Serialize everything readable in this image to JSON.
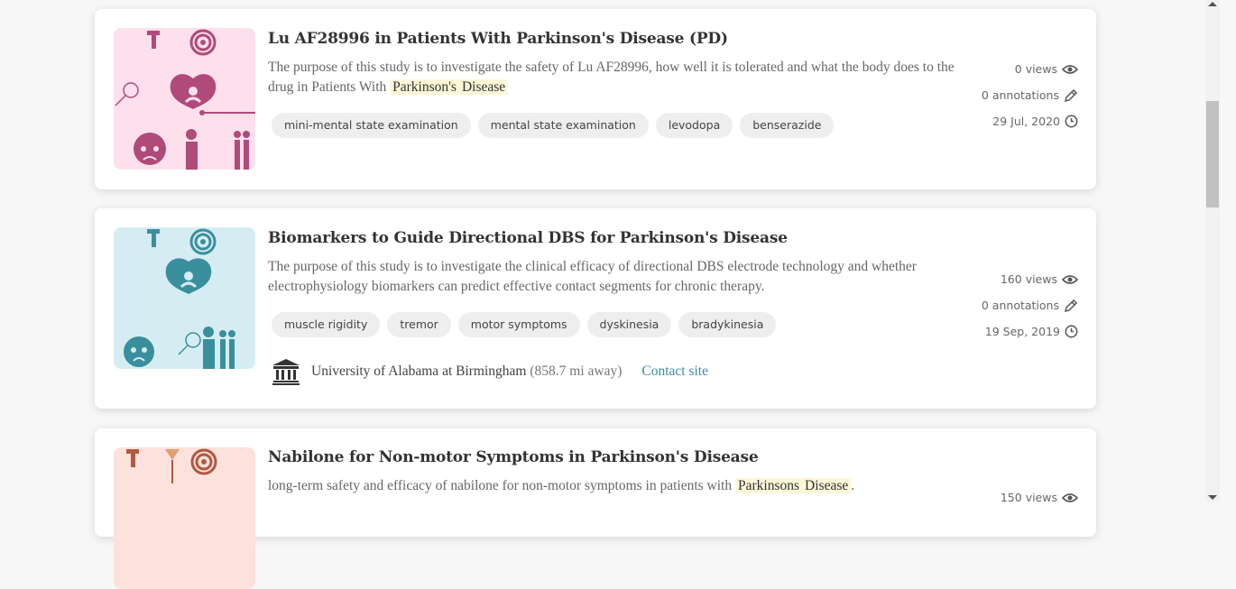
{
  "colors": {
    "pink_bg": "#fde0ec",
    "pink_fg": "#b04a7a",
    "teal_bg": "#d5edf2",
    "teal_fg": "#3a8f9d",
    "salmon_bg": "#fde1dc",
    "salmon_fg": "#b05a40",
    "highlight": "#fdf6d8",
    "link": "#3d8ba6"
  },
  "cards": [
    {
      "title": "Lu AF28996 in Patients With Parkinson's Disease (PD)",
      "desc_before": "The purpose of this study is to investigate the safety of Lu AF28996, how well it is tolerated and what the body does to the drug in Patients With",
      "highlights": [
        "Parkinson's",
        "Disease"
      ],
      "tags": [
        "mini-mental state examination",
        "mental state examination",
        "levodopa",
        "benserazide"
      ],
      "views": "0 views",
      "annotations": "0 annotations",
      "date": "29 Jul, 2020"
    },
    {
      "title": "Biomarkers to Guide Directional DBS for Parkinson's Disease",
      "desc": "The purpose of this study is to investigate the clinical efficacy of directional DBS electrode technology and whether electrophysiology biomarkers can predict effective contact segments for chronic therapy.",
      "tags": [
        "muscle rigidity",
        "tremor",
        "motor symptoms",
        "dyskinesia",
        "bradykinesia"
      ],
      "views": "160 views",
      "annotations": "0 annotations",
      "date": "19 Sep, 2019",
      "site_name": "University of Alabama at Birmingham",
      "site_distance": "(858.7 mi away)",
      "contact_label": "Contact site"
    },
    {
      "title": "Nabilone for Non-motor Symptoms in Parkinson's Disease",
      "desc_before": "long-term safety and efficacy of nabilone for non-motor symptoms in patients with",
      "highlights": [
        "Parkinsons",
        "Disease"
      ],
      "desc_after": ".",
      "views": "150 views"
    }
  ],
  "icons": {
    "views": "eye-icon",
    "annotations": "pencil-icon",
    "date": "clock-icon",
    "site": "institution-icon"
  }
}
